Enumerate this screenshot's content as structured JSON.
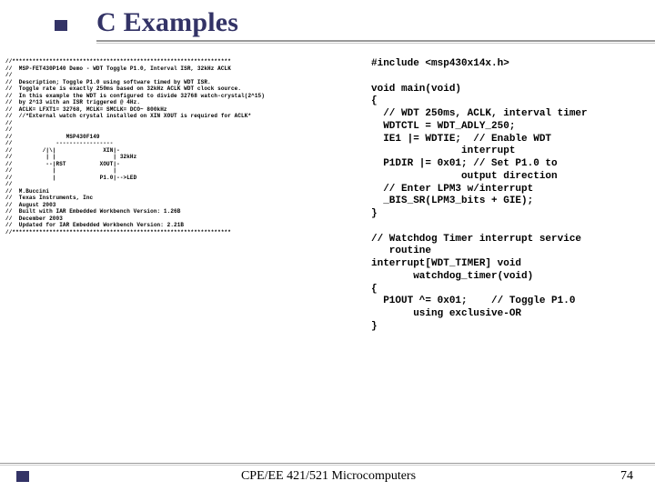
{
  "title": "C Examples",
  "left_code": "//*****************************************************************\n//  MSP-FET430P140 Demo - WDT Toggle P1.0, Interval ISR, 32kHz ACLK\n//\n//  Description; Toggle P1.0 using software timed by WDT ISR.\n//  Toggle rate is exactly 250ms based on 32kHz ACLK WDT clock source.\n//  In this example the WDT is configured to divide 32768 watch-crystal(2^15)\n//  by 2^13 with an ISR triggered @ 4Hz.\n//  ACLK= LFXT1= 32768, MCLK= SMCLK= DCO~ 800kHz\n//  //*External watch crystal installed on XIN XOUT is required for ACLK*\n//\n//\n//                MSP430F149\n//             -----------------\n//         /|\\|              XIN|-\n//          | |                 | 32kHz\n//          --|RST          XOUT|-\n//            |                 |\n//            |             P1.0|-->LED\n//\n//  M.Buccini\n//  Texas Instruments, Inc\n//  August 2003\n//  Built with IAR Embedded Workbench Version: 1.26B\n//  December 2003\n//  Updated for IAR Embedded Workbench Version: 2.21B\n//*****************************************************************",
  "right_code": "#include <msp430x14x.h>\n\nvoid main(void)\n{\n  // WDT 250ms, ACLK, interval timer\n  WDTCTL = WDT_ADLY_250;\n  IE1 |= WDTIE;  // Enable WDT\n               interrupt\n  P1DIR |= 0x01; // Set P1.0 to\n               output direction\n  // Enter LPM3 w/interrupt\n  _BIS_SR(LPM3_bits + GIE);\n}\n\n// Watchdog Timer interrupt service\n   routine\ninterrupt[WDT_TIMER] void\n       watchdog_timer(void)\n{\n  P1OUT ^= 0x01;    // Toggle P1.0\n       using exclusive-OR\n}",
  "footer": {
    "center": "CPE/EE 421/521 Microcomputers",
    "page": "74"
  }
}
